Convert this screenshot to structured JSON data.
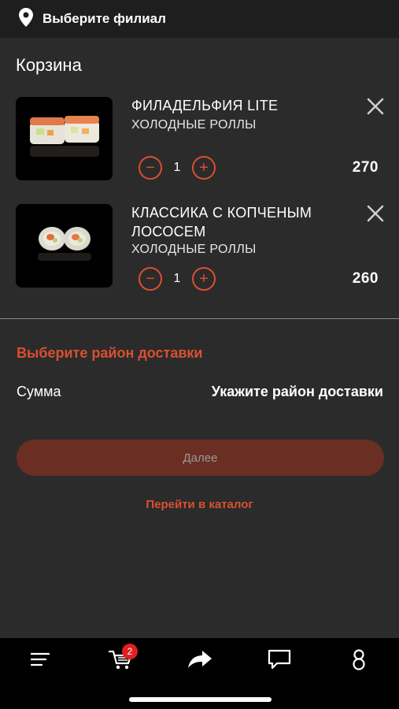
{
  "header": {
    "branch_label": "Выберите филиал"
  },
  "page": {
    "title": "Корзина"
  },
  "cart": {
    "items": [
      {
        "name": "ФИЛАДЕЛЬФИЯ LITE",
        "category": "ХОЛОДНЫЕ РОЛЛЫ",
        "quantity": "1",
        "price": "270",
        "minus": "−",
        "plus": "+"
      },
      {
        "name": "КЛАССИКА С КОПЧЕНЫМ ЛОСОСЕМ",
        "category": "ХОЛОДНЫЕ РОЛЛЫ",
        "quantity": "1",
        "price": "260",
        "minus": "−",
        "plus": "+"
      }
    ]
  },
  "summary": {
    "district_link": "Выберите район доставки",
    "sum_label": "Сумма",
    "sum_value": "Укажите район доставки"
  },
  "actions": {
    "next_label": "Далее",
    "catalog_link": "Перейти в каталог"
  },
  "tabbar": {
    "items": [
      {
        "icon": "menu-icon"
      },
      {
        "icon": "cart-icon",
        "badge": "2"
      },
      {
        "icon": "share-icon"
      },
      {
        "icon": "chat-icon"
      },
      {
        "icon": "profile-icon"
      }
    ]
  },
  "colors": {
    "background": "#2b2b2b",
    "accent": "#d95030",
    "button_disabled": "#6b2e22",
    "tabbar": "#000000",
    "badge": "#e02020"
  }
}
